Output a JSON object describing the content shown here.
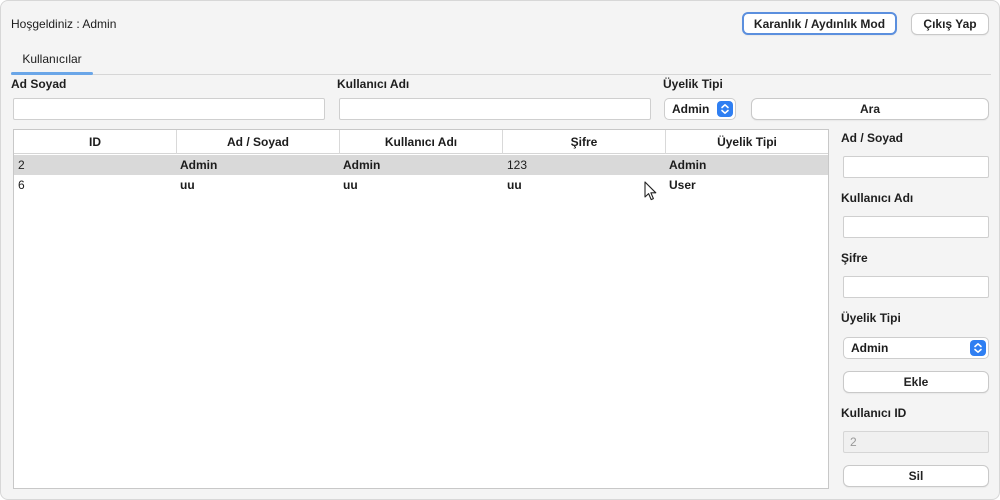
{
  "header": {
    "welcome": "Hoşgeldiniz : Admin",
    "theme_button": "Karanlık / Aydınlık Mod",
    "logout_button": "Çıkış Yap"
  },
  "tabs": [
    {
      "label": "Kullanıcılar",
      "active": true
    }
  ],
  "search": {
    "fullname_label": "Ad Soyad",
    "fullname_value": "",
    "username_label": "Kullanıcı Adı",
    "username_value": "",
    "membership_label": "Üyelik Tipi",
    "membership_value": "Admin",
    "search_button": "Ara"
  },
  "table": {
    "columns": [
      "ID",
      "Ad / Soyad",
      "Kullanıcı Adı",
      "Şifre",
      "Üyelik Tipi"
    ],
    "rows": [
      {
        "id": "2",
        "fullname": "Admin",
        "username": "Admin",
        "password": "123",
        "membership": "Admin",
        "selected": true
      },
      {
        "id": "6",
        "fullname": "uu",
        "username": "uu",
        "password": "uu",
        "membership": "User",
        "selected": false
      }
    ]
  },
  "form": {
    "fullname_label": "Ad / Soyad",
    "fullname_value": "",
    "username_label": "Kullanıcı Adı",
    "username_value": "",
    "password_label": "Şifre",
    "password_value": "",
    "membership_label": "Üyelik Tipi",
    "membership_value": "Admin",
    "add_button": "Ekle",
    "userid_label": "Kullanıcı ID",
    "userid_value": "2",
    "delete_button": "Sil"
  },
  "colors": {
    "accent": "#2f7ff2",
    "tab_underline": "#6aa6e8",
    "focus_ring": "#5b8fde",
    "selected_row": "#d9d9d9"
  },
  "icons": {
    "select_stepper": "chevron-up-down-icon",
    "cursor": "mouse-pointer-icon"
  }
}
